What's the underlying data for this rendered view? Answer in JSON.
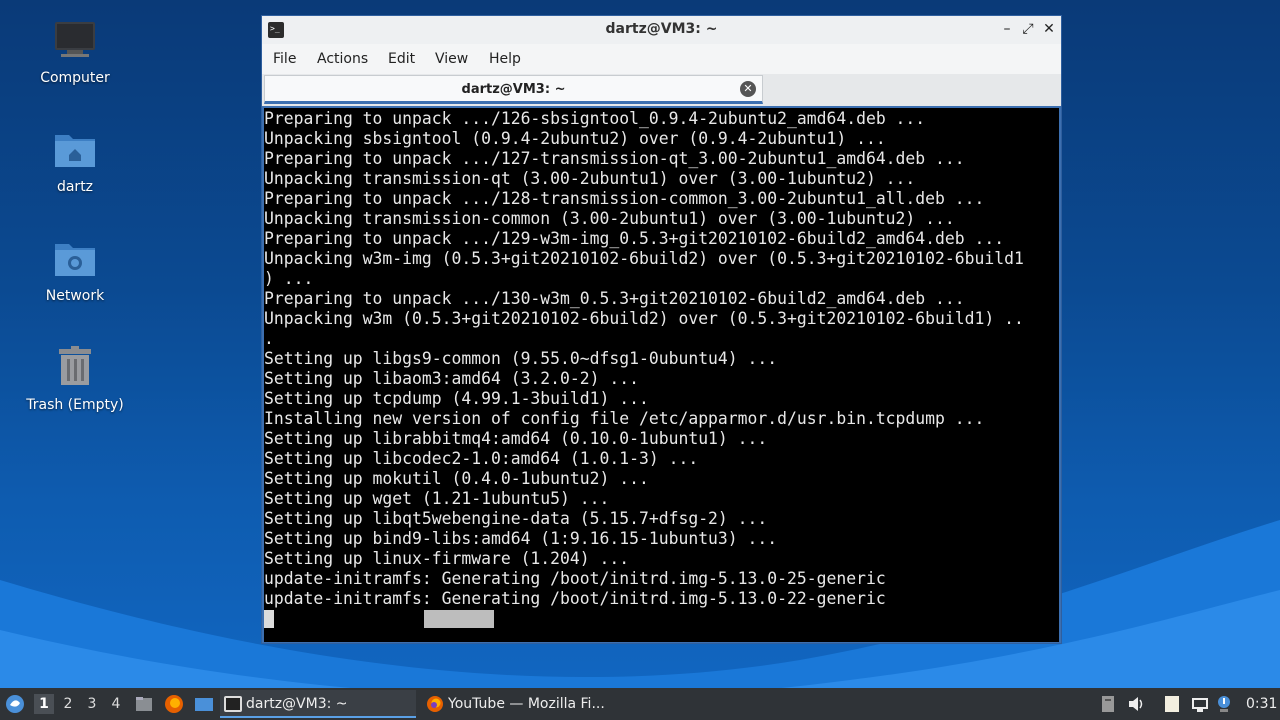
{
  "desktop": {
    "icons": [
      {
        "label": "Computer"
      },
      {
        "label": "dartz"
      },
      {
        "label": "Network"
      },
      {
        "label": "Trash (Empty)"
      }
    ]
  },
  "window": {
    "title": "dartz@VM3: ~",
    "menu": [
      "File",
      "Actions",
      "Edit",
      "View",
      "Help"
    ],
    "tab_title": "dartz@VM3: ~"
  },
  "terminal": {
    "lines": [
      "Preparing to unpack .../126-sbsigntool_0.9.4-2ubuntu2_amd64.deb ...",
      "Unpacking sbsigntool (0.9.4-2ubuntu2) over (0.9.4-2ubuntu1) ...",
      "Preparing to unpack .../127-transmission-qt_3.00-2ubuntu1_amd64.deb ...",
      "Unpacking transmission-qt (3.00-2ubuntu1) over (3.00-1ubuntu2) ...",
      "Preparing to unpack .../128-transmission-common_3.00-2ubuntu1_all.deb ...",
      "Unpacking transmission-common (3.00-2ubuntu1) over (3.00-1ubuntu2) ...",
      "Preparing to unpack .../129-w3m-img_0.5.3+git20210102-6build2_amd64.deb ...",
      "Unpacking w3m-img (0.5.3+git20210102-6build2) over (0.5.3+git20210102-6build1",
      ") ...",
      "Preparing to unpack .../130-w3m_0.5.3+git20210102-6build2_amd64.deb ...",
      "Unpacking w3m (0.5.3+git20210102-6build2) over (0.5.3+git20210102-6build1) ..",
      ".",
      "Setting up libgs9-common (9.55.0~dfsg1-0ubuntu4) ...",
      "Setting up libaom3:amd64 (3.2.0-2) ...",
      "Setting up tcpdump (4.99.1-3build1) ...",
      "Installing new version of config file /etc/apparmor.d/usr.bin.tcpdump ...",
      "Setting up librabbitmq4:amd64 (0.10.0-1ubuntu1) ...",
      "Setting up libcodec2-1.0:amd64 (1.0.1-3) ...",
      "Setting up mokutil (0.4.0-1ubuntu2) ...",
      "Setting up wget (1.21-1ubuntu5) ...",
      "Setting up libqt5webengine-data (5.15.7+dfsg-2) ...",
      "Setting up bind9-libs:amd64 (1:9.16.15-1ubuntu3) ...",
      "Setting up linux-firmware (1.204) ...",
      "update-initramfs: Generating /boot/initrd.img-5.13.0-25-generic",
      "update-initramfs: Generating /boot/initrd.img-5.13.0-22-generic"
    ]
  },
  "taskbar": {
    "workspaces": [
      "1",
      "2",
      "3",
      "4"
    ],
    "active_workspace": "1",
    "tasks": [
      {
        "label": "dartz@VM3: ~",
        "icon": "terminal-icon"
      },
      {
        "label": "YouTube — Mozilla Fi...",
        "icon": "firefox-icon"
      }
    ],
    "clock": "0:31"
  }
}
